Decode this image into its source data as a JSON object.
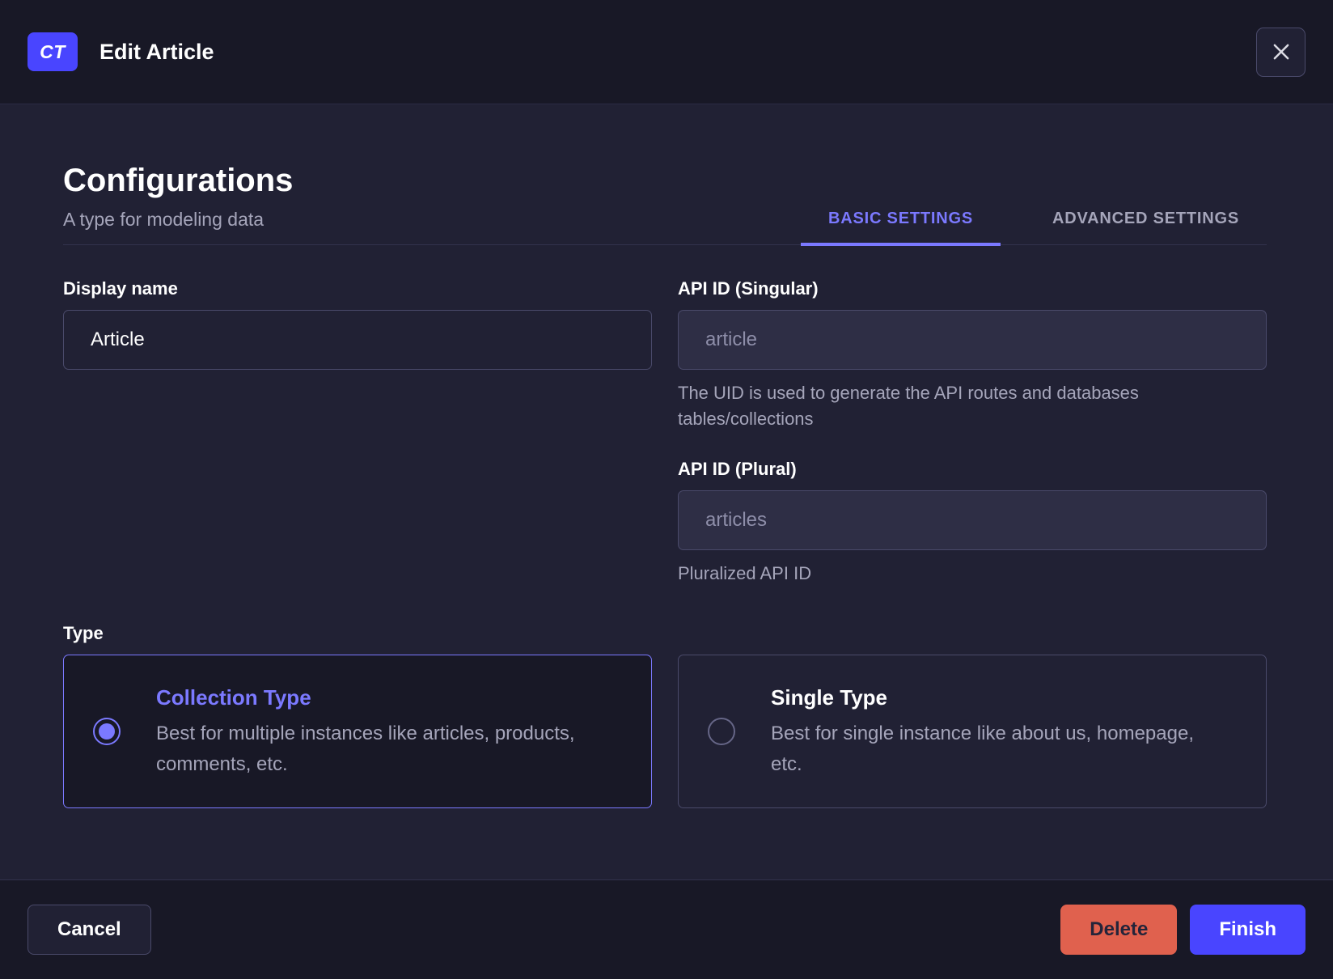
{
  "modal": {
    "badge": "CT",
    "title": "Edit Article",
    "close_icon": "close-icon"
  },
  "config": {
    "title": "Configurations",
    "subtitle": "A type for modeling data",
    "tabs": [
      {
        "label": "BASIC SETTINGS",
        "active": true
      },
      {
        "label": "ADVANCED SETTINGS",
        "active": false
      }
    ]
  },
  "form": {
    "display_name": {
      "label": "Display name",
      "value": "Article"
    },
    "api_id_singular": {
      "label": "API ID (Singular)",
      "value": "article",
      "hint": "The UID is used to generate the API routes and databases tables/collections"
    },
    "api_id_plural": {
      "label": "API ID (Plural)",
      "value": "articles",
      "hint": "Pluralized API ID"
    },
    "type": {
      "label": "Type",
      "options": [
        {
          "title": "Collection Type",
          "description": "Best for multiple instances like articles, products, comments, etc.",
          "selected": true
        },
        {
          "title": "Single Type",
          "description": "Best for single instance like about us, homepage, etc.",
          "selected": false
        }
      ]
    }
  },
  "footer": {
    "cancel": "Cancel",
    "delete": "Delete",
    "finish": "Finish"
  },
  "colors": {
    "primary": "#4945ff",
    "accent_light": "#7b79ff",
    "danger": "#e0614e",
    "header_bg": "#181826",
    "body_bg": "#212134",
    "border": "#4a4a6a",
    "divider": "#32324d",
    "muted_text": "#a5a5ba"
  }
}
